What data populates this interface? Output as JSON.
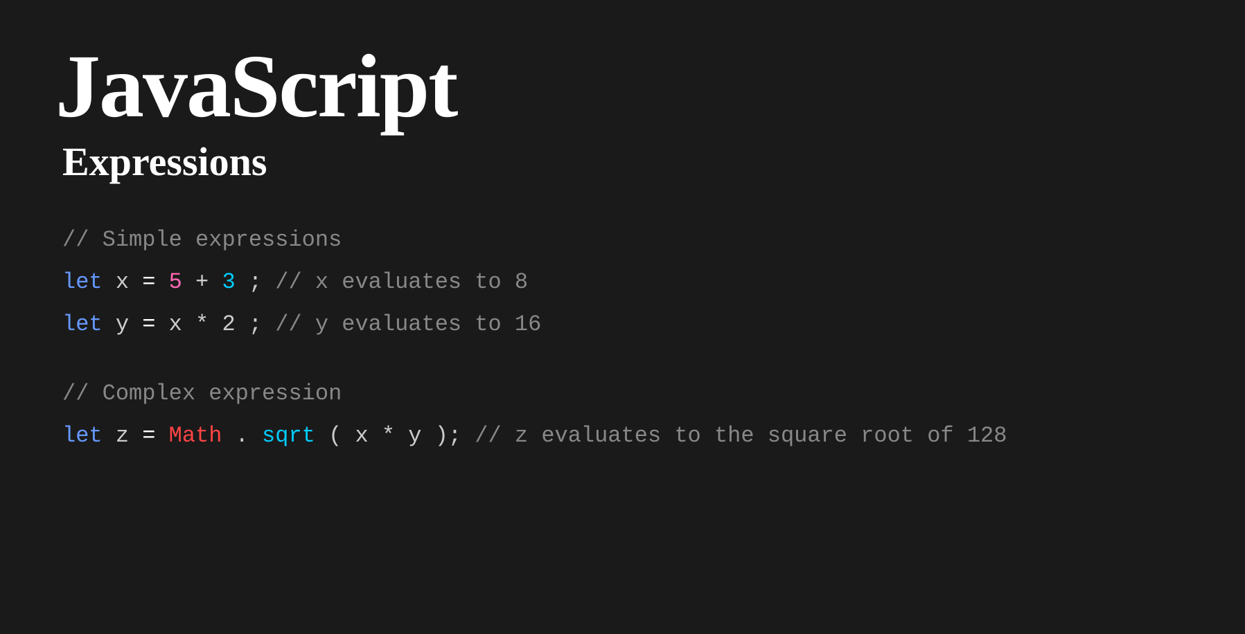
{
  "title": {
    "main": "JavaScript",
    "sub": "Expressions"
  },
  "code": {
    "comment1": "// Simple expressions",
    "line1": {
      "keyword": "let",
      "varname": " x ",
      "eq": "=",
      "num1": " 5",
      "plus": " +",
      "num2": " 3",
      "semi": ";",
      "comment": " // x evaluates to 8"
    },
    "line2": {
      "keyword": "let",
      "varname": " y ",
      "eq": "=",
      "var": " x",
      "times": " *",
      "num": " 2",
      "semi": ";",
      "comment": " // y evaluates to 16"
    },
    "comment2": "// Complex expression",
    "line3": {
      "keyword": "let",
      "varname": " z ",
      "eq": "=",
      "mathobj": " Math",
      "dot": ".",
      "method": "sqrt",
      "paren_open": "(",
      "inner": "x * y",
      "paren_close": ");",
      "comment": " // z evaluates to the square root of 128"
    }
  },
  "colors": {
    "bg": "#1a1a1a",
    "title": "#ffffff",
    "comment": "#888888",
    "keyword": "#6699ff",
    "variable": "#cccccc",
    "number_pink": "#ff69b4",
    "number_cyan": "#00ccff",
    "math_red": "#ff3333",
    "operator": "#ffffff"
  }
}
